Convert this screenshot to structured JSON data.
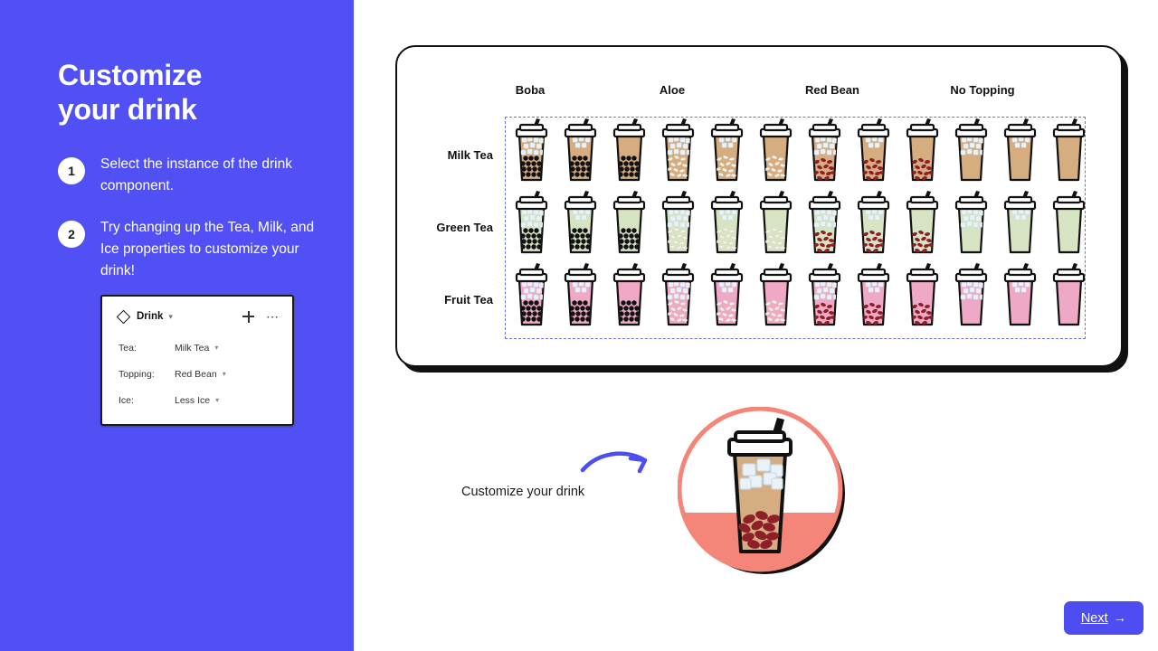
{
  "sidebar": {
    "title_line1": "Customize",
    "title_line2": "your drink",
    "bg_color": "#5050F5",
    "steps": [
      {
        "number": "1",
        "text": "Select the instance of the drink component."
      },
      {
        "number": "2",
        "text": "Try changing up the Tea, Milk, and Ice properties to customize your drink!"
      }
    ],
    "properties_panel": {
      "component_name": "Drink",
      "component_icon": "diamond-icon",
      "caret_icon": "chevron-down-icon",
      "move_icon": "move-handle-icon",
      "overflow_icon": "more-options-icon",
      "rows": [
        {
          "key": "Tea:",
          "value": "Milk Tea"
        },
        {
          "key": "Topping:",
          "value": "Red Bean"
        },
        {
          "key": "Ice:",
          "value": "Less Ice"
        }
      ]
    }
  },
  "canvas": {
    "column_headers": [
      "Boba",
      "Aloe",
      "Red Bean",
      "No Topping"
    ],
    "row_headers": [
      "Milk Tea",
      "Green Tea",
      "Fruit Tea"
    ],
    "ice_variants": [
      "Regular Ice",
      "Less Ice",
      "No Ice"
    ],
    "selection_border_color": "#6f6fe8",
    "tea_colors": {
      "Milk Tea": "#d6ad80",
      "Green Tea": "#d6e4c4",
      "Fruit Tea": "#efa9c6"
    },
    "topping_colors": {
      "Boba": "#111111",
      "Aloe": "#f6f1e4",
      "Red Bean": "#8e1f28",
      "No Topping": "none"
    },
    "ice_color": "#e9f2f8"
  },
  "hero": {
    "caption": "Customize your drink",
    "arrow_icon": "curved-arrow-icon",
    "badge_ring_color": "#f58578",
    "badge_fill_color": "#f58578",
    "drink_tea": "Milk Tea",
    "drink_topping": "Red Bean",
    "drink_ice": "Less Ice"
  },
  "footer": {
    "next_label": "Next",
    "next_arrow": "→",
    "next_bg_color": "#4d4df2"
  }
}
